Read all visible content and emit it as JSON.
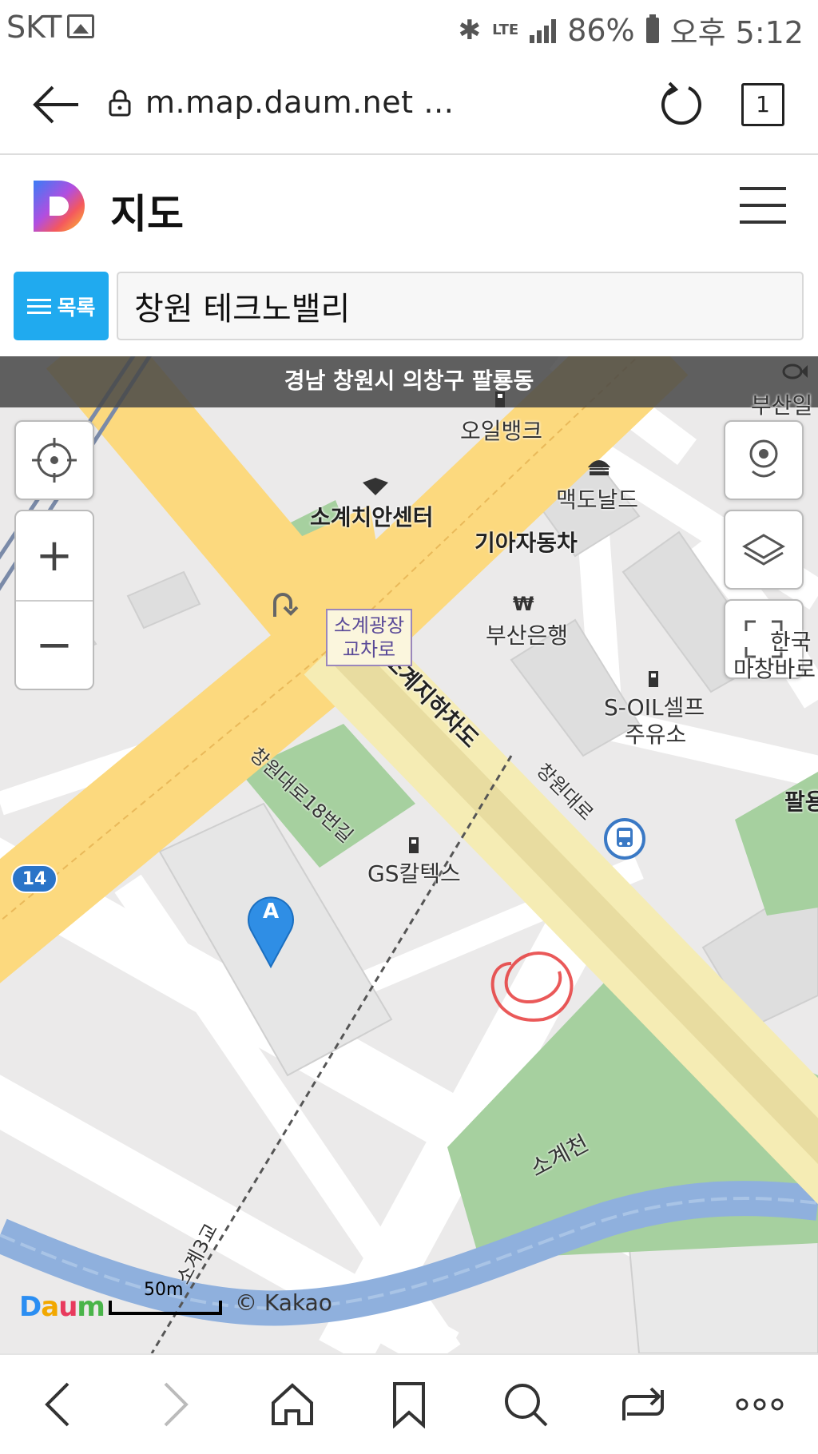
{
  "status_bar": {
    "carrier": "SKT",
    "network": "LTE",
    "battery": "86%",
    "time": "오후 5:12",
    "icons": [
      "gallery-icon",
      "bluetooth-icon",
      "lte-icon",
      "signal-icon",
      "battery-icon"
    ]
  },
  "browser": {
    "url": "m.map.daum.net …",
    "tab_count": "1",
    "icons": [
      "back-arrow-icon",
      "lock-icon",
      "reload-icon",
      "tabs-icon"
    ]
  },
  "header": {
    "title": "지도",
    "icons": [
      "daum-logo",
      "hamburger-menu-icon"
    ]
  },
  "search": {
    "list_button_label": "목록",
    "query": "창원 테크노밸리"
  },
  "map": {
    "region": "경남 창원시 의창구 팔룡동",
    "labels": {
      "oil_bank": "오일뱅크",
      "busan_top": "부산일",
      "mcdonalds": "맥도날드",
      "police": "소계치안센터",
      "kia": "기아자동차",
      "busan_bank": "부산은행",
      "hanguk_line1": "한국",
      "hanguk_line2": "마창바로",
      "soil_line1": "S-OIL셀프",
      "soil_line2": "주유소",
      "underpass": "소계지하차도",
      "road_changwon": "창원대로",
      "road_18": "창원대로18번길",
      "gs": "GS칼텍스",
      "palyong": "팔용",
      "stream": "소계천",
      "bridge": "소계3교"
    },
    "junction_line1": "소계광장",
    "junction_line2": "교차로",
    "route_number": "14",
    "marker_label": "A",
    "scale": "50m",
    "credit": "© Kakao",
    "colors": {
      "road_major": "#fcd97e",
      "road_tunnel": "#f5ecb4",
      "park": "#a6d09f",
      "river": "#8fb0dd",
      "marker": "#2f8ee5",
      "annotation": "#e53030"
    },
    "controls": [
      "current-location-icon",
      "zoom-in-button",
      "zoom-out-button",
      "roadview-icon",
      "layers-icon",
      "fullscreen-icon"
    ]
  },
  "bottom_nav": {
    "icons": [
      "nav-back-icon",
      "nav-forward-icon",
      "home-icon",
      "bookmark-icon",
      "search-icon",
      "share-icon",
      "more-icon"
    ]
  }
}
